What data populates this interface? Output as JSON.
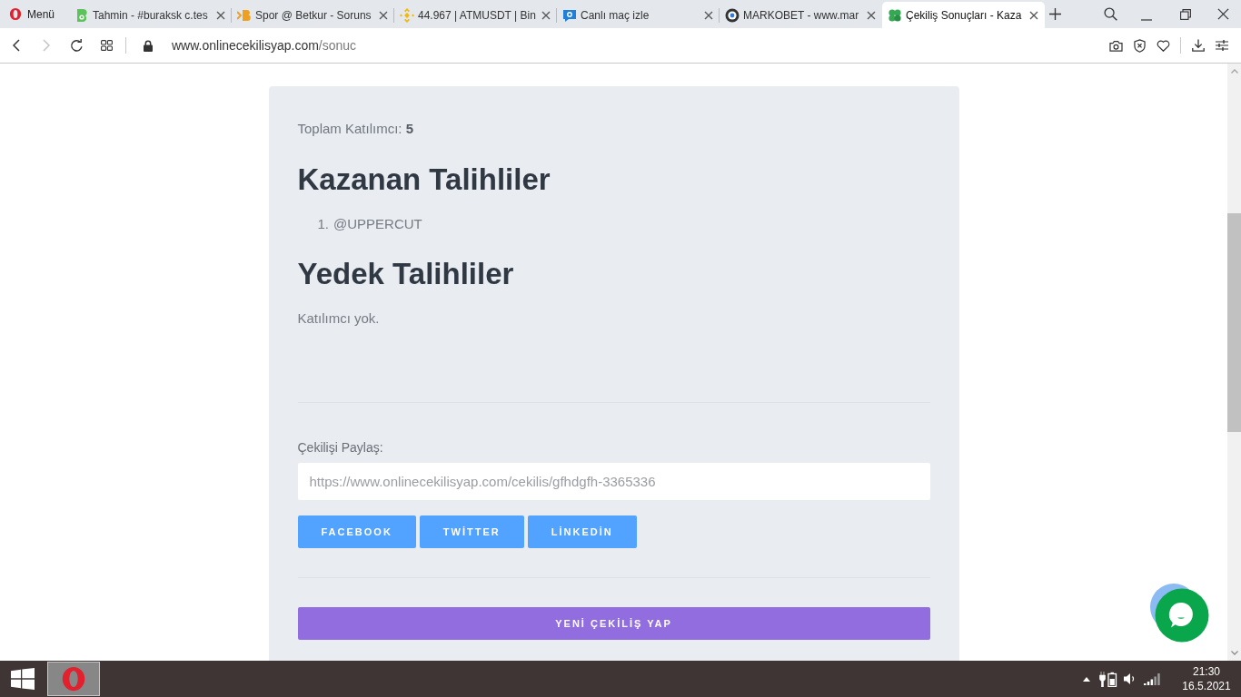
{
  "browser": {
    "menu_label": "Menü",
    "tabs": [
      {
        "title": "Tahmin - #buraksk c.tes",
        "selected": false
      },
      {
        "title": "Spor @ Betkur - Soruns",
        "selected": false
      },
      {
        "title": "44.967 | ATMUSDT | Bin",
        "selected": false
      },
      {
        "title": "Canlı maç izle",
        "selected": false
      },
      {
        "title": "MARKOBET - www.mar",
        "selected": false
      },
      {
        "title": "Çekiliş Sonuçları - Kaza",
        "selected": true
      }
    ],
    "address": {
      "host": "www.onlinecekilisyap.com",
      "path": "/sonuc",
      "forward_disabled": true
    }
  },
  "page": {
    "total_participants": "Toplam Katılımcı: **5**",
    "winners": {
      "heading": "Kazanan Talihliler",
      "items": [
        {
          "number": "1.",
          "name": "@UPPERCUT"
        }
      ]
    },
    "reserves": {
      "heading": "Yedek Talihliler",
      "empty_text": "Katılımcı yok."
    },
    "share": {
      "label": "Çekilişi Paylaş:",
      "link": "https://www.onlinecekilisyap.com/cekilis/gfhdgfh-3365336",
      "buttons": [
        {
          "label": "FACEBOOK"
        },
        {
          "label": "TWİTTER"
        },
        {
          "label": "LİNKEDİN"
        }
      ]
    },
    "new_draw_button": "YENİ ÇEKİLİŞ YAP"
  },
  "taskbar": {
    "time": "21:30",
    "date": "16.5.2021"
  }
}
